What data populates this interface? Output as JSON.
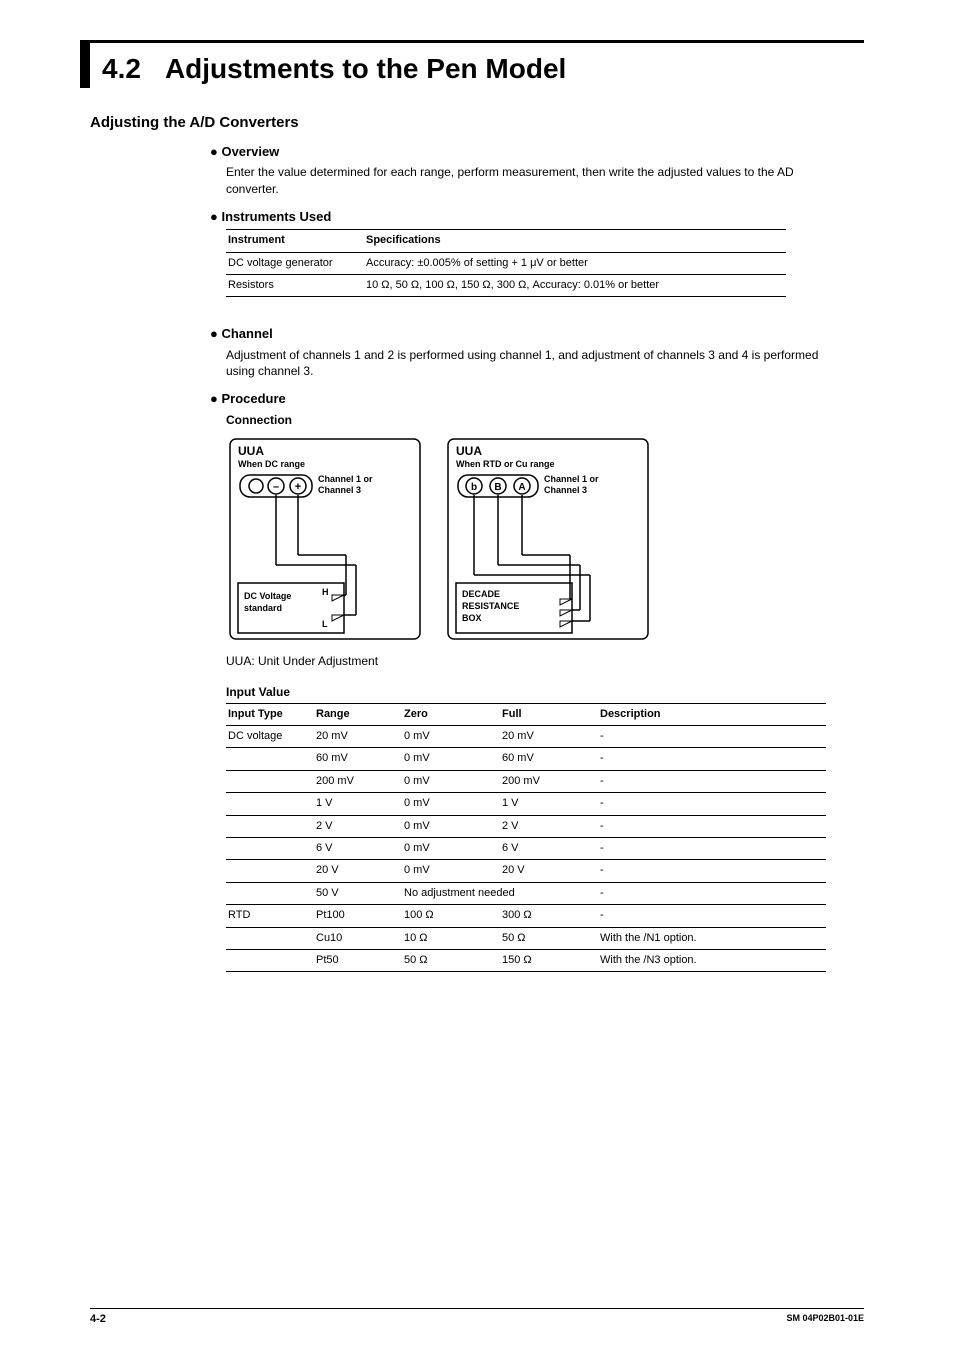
{
  "section": {
    "number": "4.2",
    "title": "Adjustments to the Pen Model"
  },
  "heading1": "Adjusting the A/D Converters",
  "overview": {
    "label": "Overview",
    "text": "Enter the value determined for each range, perform measurement, then write the adjusted values to the AD converter."
  },
  "instruments": {
    "label": "Instruments Used",
    "headers": [
      "Instrument",
      "Specifications"
    ],
    "rows": [
      [
        "DC voltage generator",
        "Accuracy: ±0.005% of setting + 1 μV or better"
      ],
      [
        "Resistors",
        "10 Ω, 50 Ω, 100 Ω, 150 Ω, 300 Ω, Accuracy: 0.01% or better"
      ]
    ]
  },
  "channel": {
    "label": "Channel",
    "text": "Adjustment of channels 1 and 2 is performed using channel 1, and adjustment of channels 3 and 4 is performed using channel 3."
  },
  "procedure": {
    "label": "Procedure",
    "connection_label": "Connection",
    "uua_caption": "UUA: Unit Under Adjustment",
    "diagrams": {
      "left": {
        "title": "UUA",
        "subtitle": "When DC range",
        "terminal_minus": "–",
        "terminal_plus": "+",
        "ch_label_a": "Channel 1 or",
        "ch_label_b": "Channel 3",
        "box_line1": "DC Voltage",
        "box_line2": "standard",
        "pin_h": "H",
        "pin_l": "L"
      },
      "right": {
        "title": "UUA",
        "subtitle": "When RTD or Cu range",
        "terminal_b1": "b",
        "terminal_B": "B",
        "terminal_A": "A",
        "ch_label_a": "Channel 1 or",
        "ch_label_b": "Channel 3",
        "box_line1": "DECADE",
        "box_line2": "RESISTANCE",
        "box_line3": "BOX"
      }
    }
  },
  "input_value": {
    "label": "Input Value",
    "headers": [
      "Input Type",
      "Range",
      "Zero",
      "Full",
      "Description"
    ],
    "rows": [
      [
        "DC voltage",
        "20 mV",
        "0 mV",
        "20 mV",
        "-"
      ],
      [
        "",
        "60 mV",
        "0 mV",
        "60 mV",
        "-"
      ],
      [
        "",
        "200 mV",
        "0 mV",
        "200 mV",
        "-"
      ],
      [
        "",
        "1 V",
        "0 mV",
        "1 V",
        "-"
      ],
      [
        "",
        "2 V",
        "0 mV",
        "2 V",
        "-"
      ],
      [
        "",
        "6 V",
        "0 mV",
        "6 V",
        "-"
      ],
      [
        "",
        "20 V",
        "0 mV",
        "20 V",
        "-"
      ],
      [
        "",
        "50 V",
        "No adjustment needed",
        "",
        "-"
      ],
      [
        "RTD",
        "Pt100",
        "100 Ω",
        "300 Ω",
        "-"
      ],
      [
        "",
        "Cu10",
        "10 Ω",
        "50 Ω",
        "With the /N1 option."
      ],
      [
        "",
        "Pt50",
        "50 Ω",
        "150 Ω",
        "With the /N3 option."
      ]
    ]
  },
  "footer": {
    "page": "4-2",
    "doc": "SM 04P02B01-01E"
  }
}
